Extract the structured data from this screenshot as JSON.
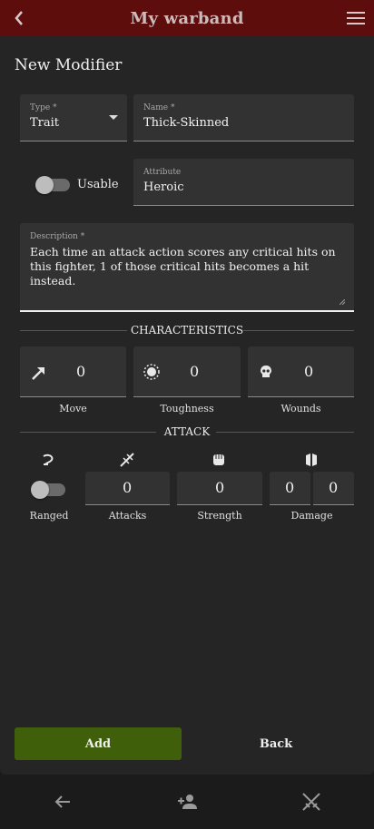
{
  "appbar": {
    "title": "My warband",
    "back_icon": "chevron-left-icon",
    "menu_icon": "hamburger-menu-icon"
  },
  "form": {
    "heading": "New Modifier",
    "type": {
      "label": "Type *",
      "value": "Trait"
    },
    "name": {
      "label": "Name *",
      "value": "Thick-Skinned"
    },
    "usable": {
      "label": "Usable",
      "on": false
    },
    "attribute": {
      "label": "Attribute",
      "value": "Heroic"
    },
    "description": {
      "label": "Description *",
      "value": "Each time an attack action scores any critical hits on this fighter, 1 of those critical hits becomes a hit instead."
    }
  },
  "characteristics": {
    "title": "CHARACTERISTICS",
    "move": {
      "caption": "Move",
      "value": "0",
      "icon": "move-arrow-icon"
    },
    "toughness": {
      "caption": "Toughness",
      "value": "0",
      "icon": "toughness-icon"
    },
    "wounds": {
      "caption": "Wounds",
      "value": "0",
      "icon": "skull-icon"
    }
  },
  "attack": {
    "title": "ATTACK",
    "ranged": {
      "caption": "Ranged",
      "on": false,
      "icon": "ranged-icon"
    },
    "attacks": {
      "caption": "Attacks",
      "value": "0",
      "icon": "attacks-icon"
    },
    "strength": {
      "caption": "Strength",
      "value": "0",
      "icon": "fist-icon"
    },
    "damage": {
      "caption": "Damage",
      "value_min": "0",
      "value_max": "0",
      "icon": "damage-icon"
    }
  },
  "actions": {
    "add": "Add",
    "back": "Back"
  },
  "bottom_nav": {
    "items": [
      "back-arrow-icon",
      "add-person-icon",
      "crossed-swords-icon"
    ]
  },
  "colors": {
    "appbar": "#5e0d0d",
    "add_button": "#3f5f0b",
    "panel": "#252525",
    "field": "#323232"
  }
}
